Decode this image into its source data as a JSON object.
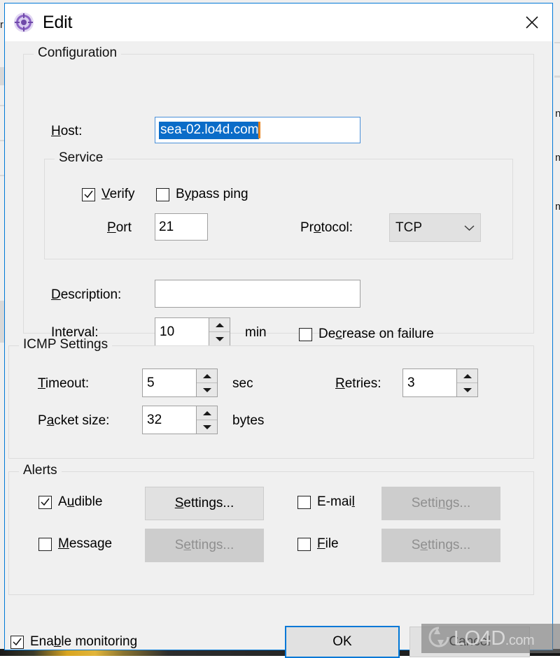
{
  "window": {
    "title": "Edit",
    "icon": "target-crosshair-icon",
    "close_label": "×",
    "accent": "#0078d7",
    "face": "#f0f0f0"
  },
  "configuration": {
    "group_label": "Configuration",
    "host": {
      "label_pre": "",
      "label_mnemonic": "H",
      "label_post": "ost:",
      "value": "sea-02.lo4d.com",
      "selected": true,
      "focused": true,
      "selection_color": "#0a6cc8",
      "caret_color": "#e8821a"
    },
    "service": {
      "group_label": "Service",
      "verify": {
        "label_pre": "",
        "label_mnemonic": "V",
        "label_post": "erify",
        "checked": true
      },
      "bypass_ping": {
        "label_pre": "B",
        "label_mnemonic": "y",
        "label_post": "pass ping",
        "checked": false
      },
      "port": {
        "label_pre": "",
        "label_mnemonic": "P",
        "label_post": "ort",
        "value": "21"
      },
      "protocol": {
        "label_pre": "Pr",
        "label_mnemonic": "o",
        "label_post": "tocol:",
        "value": "TCP",
        "options": [
          "TCP"
        ]
      }
    },
    "description": {
      "label_pre": "",
      "label_mnemonic": "D",
      "label_post": "escription:",
      "value": "",
      "placeholder": ""
    },
    "interval": {
      "label_pre": "",
      "label_mnemonic": "I",
      "label_post": "nterval:",
      "value": "10",
      "unit": "min"
    },
    "decrease_on_failure": {
      "label_pre": "De",
      "label_mnemonic": "c",
      "label_post": "rease on failure",
      "checked": false
    }
  },
  "icmp": {
    "group_label": "ICMP Settings",
    "timeout": {
      "label_pre": "",
      "label_mnemonic": "T",
      "label_post": "imeout:",
      "value": "5",
      "unit": "sec"
    },
    "retries": {
      "label_pre": "",
      "label_mnemonic": "R",
      "label_post": "etries:",
      "value": "3"
    },
    "packet_size": {
      "label_pre": "P",
      "label_mnemonic": "a",
      "label_post": "cket size:",
      "value": "32",
      "unit": "bytes"
    }
  },
  "alerts": {
    "group_label": "Alerts",
    "audible": {
      "label_pre": "A",
      "label_mnemonic": "u",
      "label_post": "dible",
      "checked": true,
      "settings_pre": "",
      "settings_mnemonic": "S",
      "settings_post": "ettings...",
      "settings_enabled": true
    },
    "email": {
      "label_pre": "E-mai",
      "label_mnemonic": "l",
      "label_post": "",
      "checked": false,
      "settings_pre": "Setti",
      "settings_mnemonic": "n",
      "settings_post": "gs...",
      "settings_enabled": false
    },
    "message": {
      "label_pre": "",
      "label_mnemonic": "M",
      "label_post": "essage",
      "checked": false,
      "settings_pre": "S",
      "settings_mnemonic": "e",
      "settings_post": "ttings...",
      "settings_enabled": false
    },
    "file": {
      "label_pre": "",
      "label_mnemonic": "F",
      "label_post": "ile",
      "checked": false,
      "settings_pre": "S",
      "settings_mnemonic": "e",
      "settings_post": "ttings...",
      "settings_enabled": false
    }
  },
  "footer": {
    "enable_monitoring": {
      "label_pre": "Ena",
      "label_mnemonic": "b",
      "label_post": "le monitoring",
      "checked": true
    },
    "ok_label": "OK",
    "cancel_label": "Cancel",
    "default_button": "OK"
  },
  "watermark": {
    "text": "LO4D",
    "domain": ".com"
  },
  "background": {
    "fragments": [
      "r",
      "n",
      "m",
      "m"
    ]
  }
}
